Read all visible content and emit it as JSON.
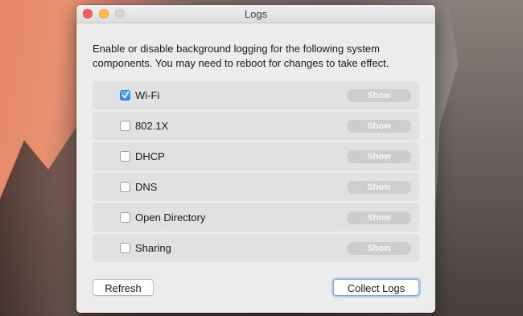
{
  "window": {
    "title": "Logs"
  },
  "description": "Enable or disable background logging for the following system components. You may need to reboot for changes to take effect.",
  "components": [
    {
      "label": "Wi-Fi",
      "checked": true,
      "show_label": "Show"
    },
    {
      "label": "802.1X",
      "checked": false,
      "show_label": "Show"
    },
    {
      "label": "DHCP",
      "checked": false,
      "show_label": "Show"
    },
    {
      "label": "DNS",
      "checked": false,
      "show_label": "Show"
    },
    {
      "label": "Open Directory",
      "checked": false,
      "show_label": "Show"
    },
    {
      "label": "Sharing",
      "checked": false,
      "show_label": "Show"
    }
  ],
  "buttons": {
    "refresh_label": "Refresh",
    "collect_label": "Collect Logs"
  },
  "colors": {
    "accent": "#2b7ff0",
    "close": "#fc605c",
    "minimize": "#fdbc40"
  }
}
